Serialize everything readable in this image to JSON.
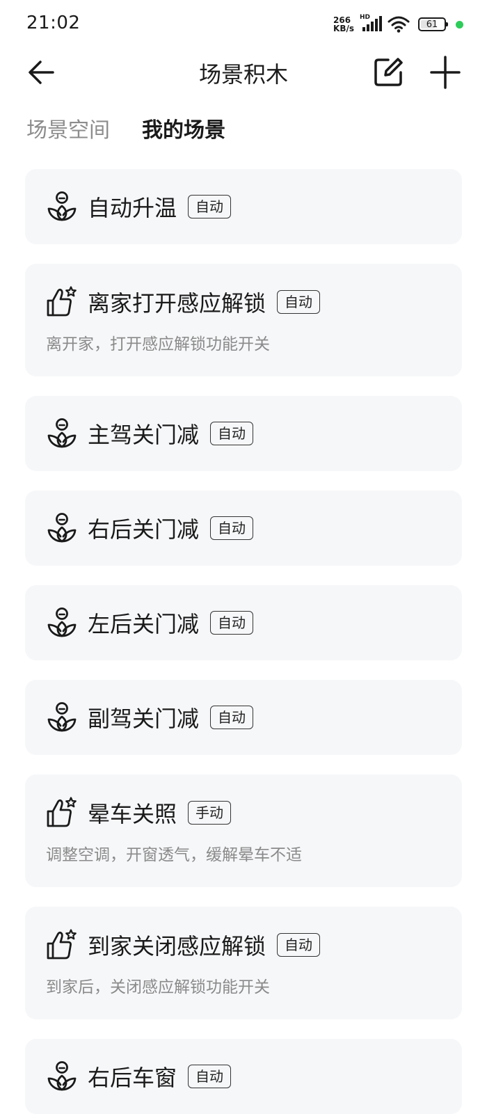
{
  "status_bar": {
    "time": "21:02",
    "net_speed_value": "266",
    "net_speed_unit": "KB/s",
    "hd_label": "HD",
    "battery_level": "61"
  },
  "header": {
    "title": "场景积木",
    "back_icon": "arrow-left-icon",
    "edit_icon": "edit-icon",
    "add_icon": "plus-icon"
  },
  "tabs": [
    {
      "label": "场景空间",
      "active": false
    },
    {
      "label": "我的场景",
      "active": true
    }
  ],
  "scenes": [
    {
      "icon": "lotus-icon",
      "title": "自动升温",
      "badge": "自动",
      "desc": ""
    },
    {
      "icon": "thumbs-up-star-icon",
      "title": "离家打开感应解锁",
      "badge": "自动",
      "desc": "离开家，打开感应解锁功能开关"
    },
    {
      "icon": "lotus-icon",
      "title": "主驾关门减",
      "badge": "自动",
      "desc": ""
    },
    {
      "icon": "lotus-icon",
      "title": "右后关门减",
      "badge": "自动",
      "desc": ""
    },
    {
      "icon": "lotus-icon",
      "title": "左后关门减",
      "badge": "自动",
      "desc": ""
    },
    {
      "icon": "lotus-icon",
      "title": "副驾关门减",
      "badge": "自动",
      "desc": ""
    },
    {
      "icon": "thumbs-up-star-icon",
      "title": "晕车关照",
      "badge": "手动",
      "desc": "调整空调，开窗透气，缓解晕车不适"
    },
    {
      "icon": "thumbs-up-star-icon",
      "title": "到家关闭感应解锁",
      "badge": "自动",
      "desc": "到家后，关闭感应解锁功能开关"
    },
    {
      "icon": "lotus-icon",
      "title": "右后车窗",
      "badge": "自动",
      "desc": ""
    }
  ]
}
